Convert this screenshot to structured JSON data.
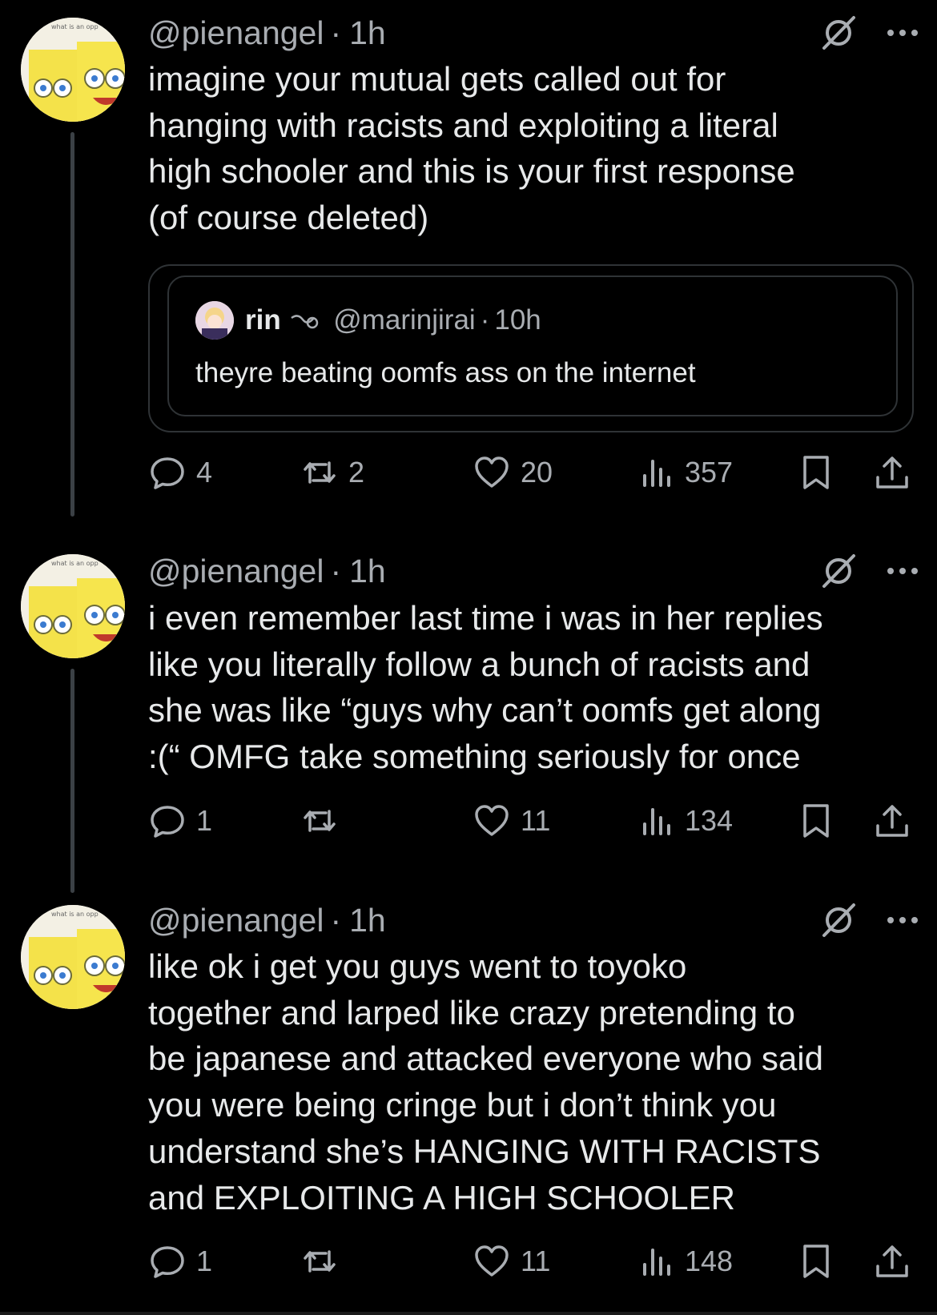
{
  "tweets": [
    {
      "handle": "@pienangel",
      "sep": "·",
      "time": "1h",
      "text": "imagine your mutual gets called out for\nhanging with racists and exploiting a literal\nhigh schooler and this is your first response\n(of course deleted)",
      "avatar_caption": "what is an opp",
      "quote": {
        "name": "rin",
        "handle": "@marinjirai",
        "sep": "·",
        "time": "10h",
        "text": "theyre beating oomfs ass on the internet"
      },
      "stats": {
        "replies": "4",
        "reposts": "2",
        "likes": "20",
        "views": "357"
      }
    },
    {
      "handle": "@pienangel",
      "sep": "·",
      "time": "1h",
      "text": "i even remember last time i was in her replies\nlike you literally follow a bunch of racists and\nshe was like “guys why can’t oomfs get along\n:(“ OMFG take something seriously for once",
      "avatar_caption": "what is an opp",
      "stats": {
        "replies": "1",
        "reposts": "",
        "likes": "11",
        "views": "134"
      }
    },
    {
      "handle": "@pienangel",
      "sep": "·",
      "time": "1h",
      "text": "like ok i get you guys went to toyoko\ntogether and larped like crazy pretending to\nbe japanese and attacked everyone who said\nyou were being cringe but i don’t think you\nunderstand she’s HANGING WITH RACISTS\nand EXPLOITING A HIGH SCHOOLER",
      "avatar_caption": "what is an opp",
      "stats": {
        "replies": "1",
        "reposts": "",
        "likes": "11",
        "views": "148"
      }
    }
  ],
  "icons": {
    "reply": "reply-icon",
    "repost": "repost-icon",
    "like": "heart-icon",
    "views": "views-icon",
    "bookmark": "bookmark-icon",
    "share": "share-icon",
    "grok": "grok-icon",
    "more": "more-icon"
  },
  "colors": {
    "background": "#000000",
    "text": "#e7e9ea",
    "muted": "#a9adb2",
    "border": "#2f3336"
  }
}
